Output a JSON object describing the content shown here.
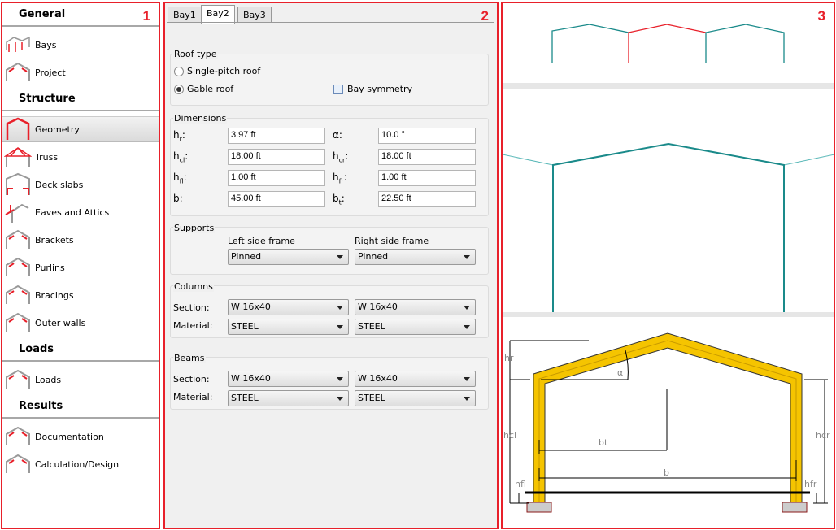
{
  "panel_numbers": [
    "1",
    "2",
    "3"
  ],
  "sidebar": {
    "sections": [
      {
        "title": "General",
        "items": [
          {
            "label": "Bays",
            "icon": "bays-icon"
          },
          {
            "label": "Project",
            "icon": "project-icon"
          }
        ]
      },
      {
        "title": "Structure",
        "items": [
          {
            "label": "Geometry",
            "icon": "geometry-icon",
            "selected": true
          },
          {
            "label": "Truss",
            "icon": "truss-icon"
          },
          {
            "label": "Deck slabs",
            "icon": "deck-slabs-icon"
          },
          {
            "label": "Eaves and Attics",
            "icon": "eaves-icon"
          },
          {
            "label": "Brackets",
            "icon": "brackets-icon"
          },
          {
            "label": "Purlins",
            "icon": "purlins-icon"
          },
          {
            "label": "Bracings",
            "icon": "bracings-icon"
          },
          {
            "label": "Outer walls",
            "icon": "outer-walls-icon"
          }
        ]
      },
      {
        "title": "Loads",
        "items": [
          {
            "label": "Loads",
            "icon": "loads-icon"
          }
        ]
      },
      {
        "title": "Results",
        "items": [
          {
            "label": "Documentation",
            "icon": "documentation-icon"
          },
          {
            "label": "Calculation/Design",
            "icon": "calculation-icon"
          }
        ]
      }
    ]
  },
  "tabs": [
    {
      "label": "Bay1"
    },
    {
      "label": "Bay2",
      "active": true
    },
    {
      "label": "Bay3"
    }
  ],
  "roof_type": {
    "title": "Roof type",
    "options": [
      "Single-pitch roof",
      "Gable roof"
    ],
    "selected": "Gable roof",
    "bay_symmetry_label": "Bay symmetry",
    "bay_symmetry": false
  },
  "dimensions": {
    "title": "Dimensions",
    "hr": {
      "main": "h",
      "sub": "r",
      "value": "3.97 ft"
    },
    "alpha": {
      "main": "α",
      "sub": "",
      "value": "10.0 °"
    },
    "hcl": {
      "main": "h",
      "sub": "cl",
      "value": "18.00 ft"
    },
    "hcr": {
      "main": "h",
      "sub": "cr",
      "value": "18.00 ft"
    },
    "hfl": {
      "main": "h",
      "sub": "fl",
      "value": "1.00 ft"
    },
    "hfr": {
      "main": "h",
      "sub": "fr",
      "value": "1.00 ft"
    },
    "b": {
      "main": "b",
      "sub": "",
      "value": "45.00 ft"
    },
    "bt": {
      "main": "b",
      "sub": "t",
      "value": "22.50 ft"
    }
  },
  "supports": {
    "title": "Supports",
    "left_label": "Left side frame",
    "right_label": "Right side frame",
    "left": "Pinned",
    "right": "Pinned"
  },
  "columns": {
    "title": "Columns",
    "section_label": "Section:",
    "material_label": "Material:",
    "section_left": "W 16x40",
    "section_right": "W 16x40",
    "material_left": "STEEL",
    "material_right": "STEEL"
  },
  "beams": {
    "title": "Beams",
    "section_label": "Section:",
    "material_label": "Material:",
    "section_left": "W 16x40",
    "section_right": "W 16x40",
    "material_left": "STEEL",
    "material_right": "STEEL"
  },
  "diagram": {
    "labels": {
      "hr": "hr",
      "alpha": "α",
      "hcl": "hcl",
      "hcr": "hcr",
      "bt": "bt",
      "b": "b",
      "hfl": "hfl",
      "hfr": "hfr"
    }
  },
  "colors": {
    "accent": "#e8202a",
    "frame": "#1a8a8a",
    "frame_light": "#5ab8b8",
    "member": "#f5c400"
  }
}
